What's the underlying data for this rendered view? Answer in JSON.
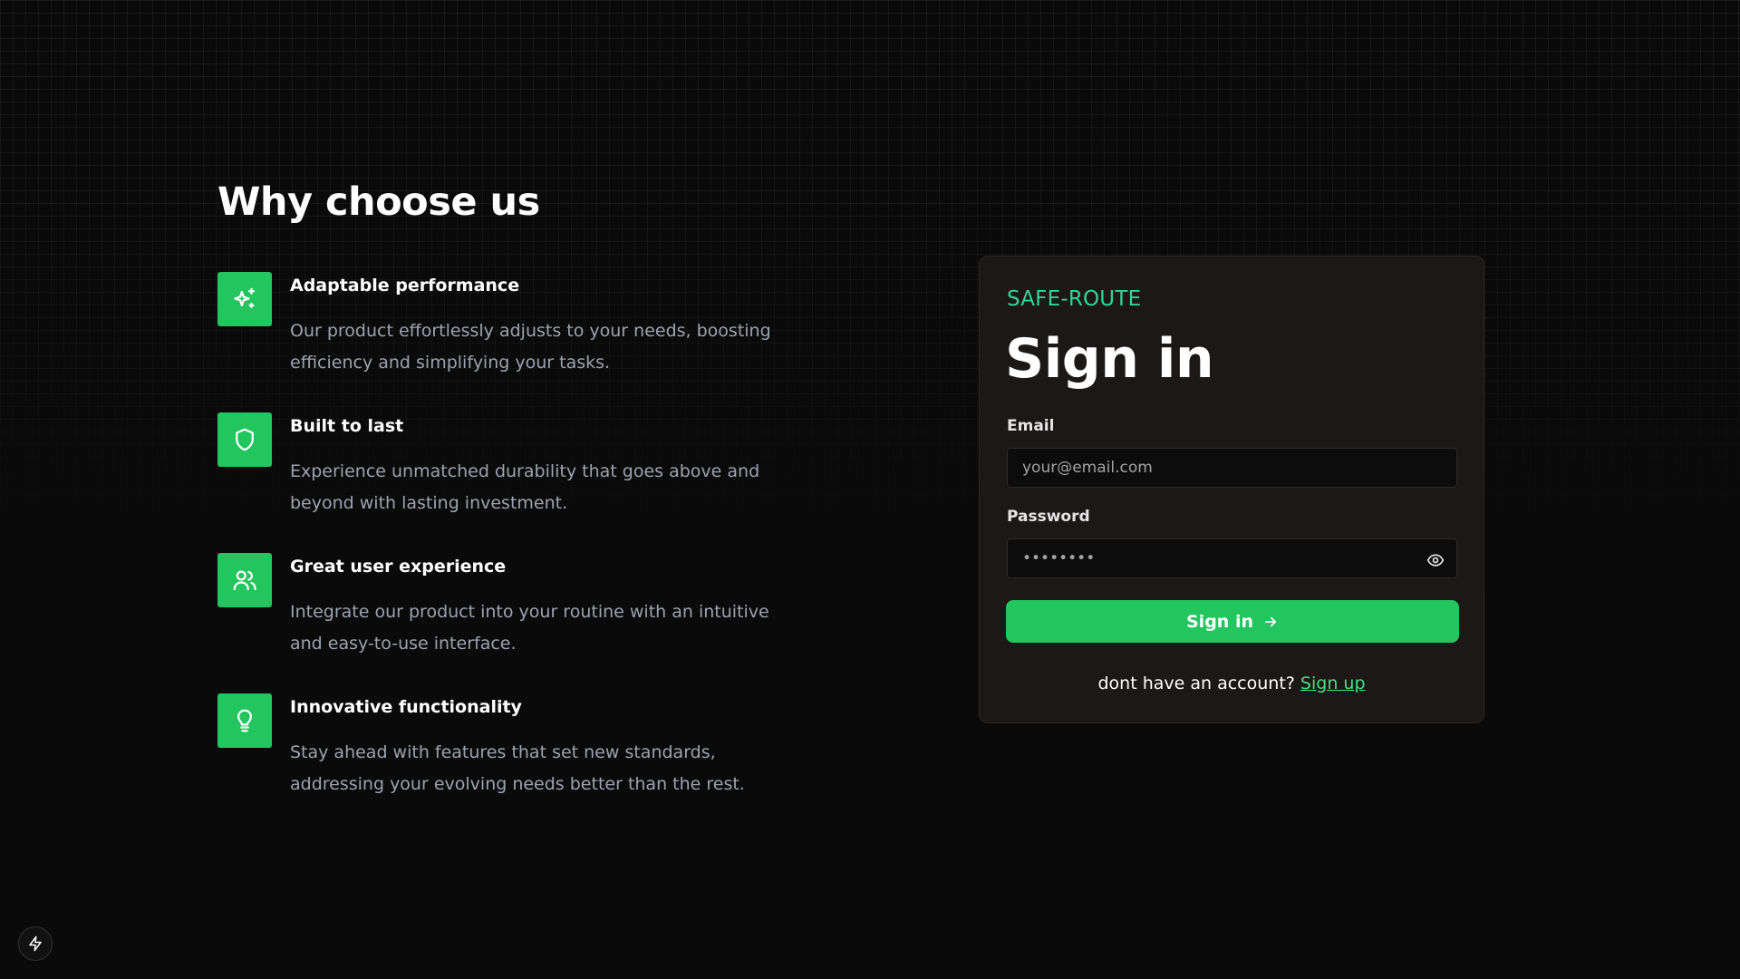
{
  "left": {
    "title": "Why choose us",
    "features": [
      {
        "icon": "sparkles-icon",
        "title": "Adaptable performance",
        "description": "Our product effortlessly adjusts to your needs, boosting efficiency and simplifying your tasks."
      },
      {
        "icon": "shield-icon",
        "title": "Built to last",
        "description": "Experience unmatched durability that goes above and beyond with lasting investment."
      },
      {
        "icon": "users-icon",
        "title": "Great user experience",
        "description": "Integrate our product into your routine with an intuitive and easy-to-use interface."
      },
      {
        "icon": "lightbulb-icon",
        "title": "Innovative functionality",
        "description": "Stay ahead with features that set new standards, addressing your evolving needs better than the rest."
      }
    ]
  },
  "card": {
    "brand": "SAFE-ROUTE",
    "title": "Sign in",
    "email_label": "Email",
    "email_placeholder": "your@email.com",
    "password_label": "Password",
    "password_placeholder": "••••••••",
    "submit_label": "Sign in",
    "signup_prompt": "dont have an account?",
    "signup_link": "Sign up"
  },
  "colors": {
    "accent": "#22c55e",
    "brand_text": "#34d399",
    "card_bg": "#1b1817",
    "page_bg": "#0a0a0a"
  }
}
